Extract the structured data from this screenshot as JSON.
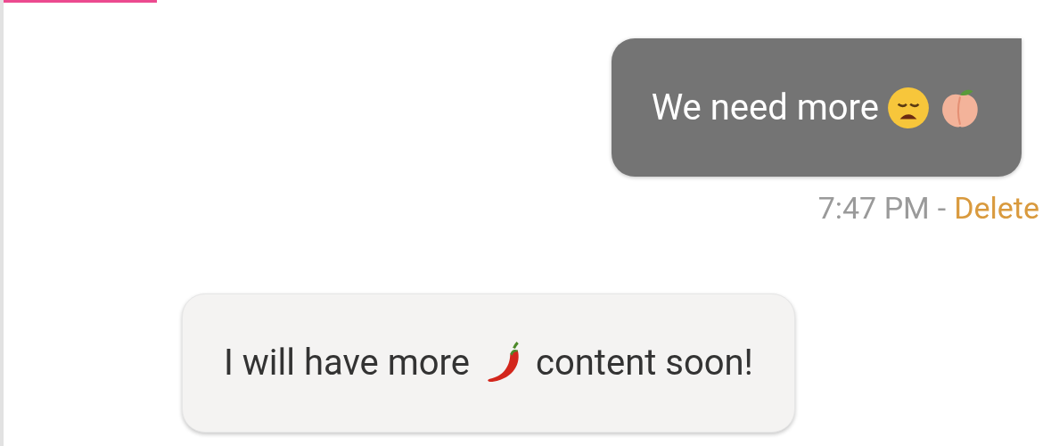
{
  "messages": [
    {
      "kind": "outgoing",
      "parts": [
        {
          "kind": "text",
          "text": "We need more"
        },
        {
          "kind": "weary"
        },
        {
          "kind": "peach"
        }
      ],
      "time": "7:47 PM",
      "separator": "-",
      "action": "Delete"
    },
    {
      "kind": "incoming",
      "parts": [
        {
          "kind": "text",
          "text": "I will have more"
        },
        {
          "kind": "pepper"
        },
        {
          "kind": "text",
          "text": "content soon!"
        }
      ]
    }
  ]
}
